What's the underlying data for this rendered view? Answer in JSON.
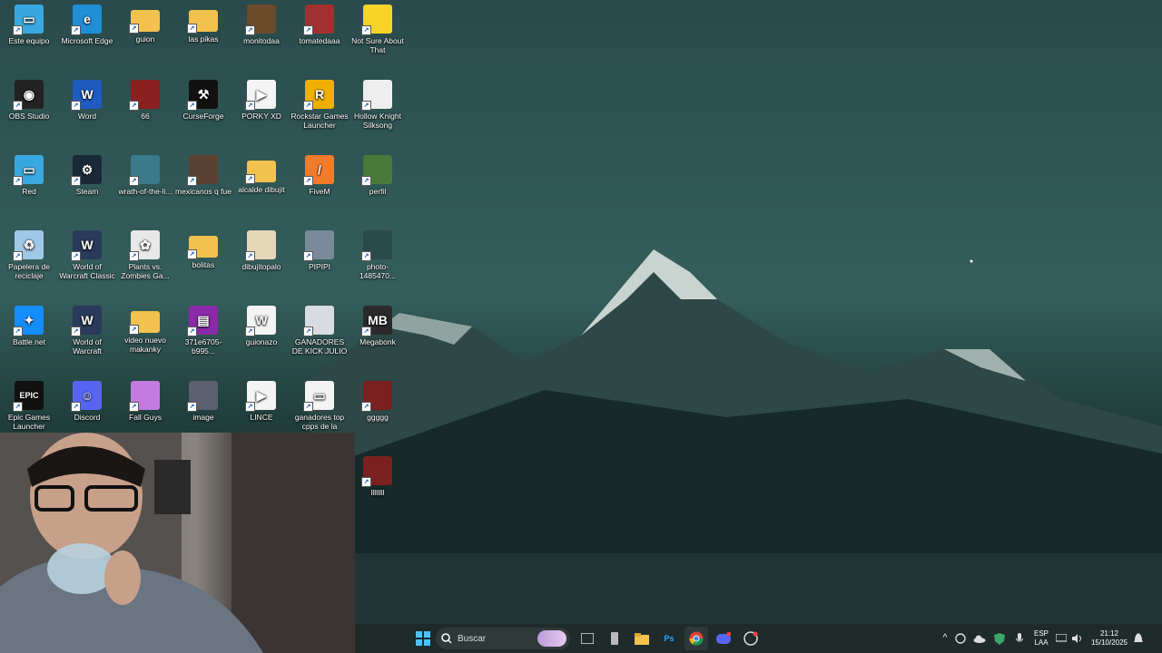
{
  "desktop": {
    "icons": [
      {
        "label": "Este equipo",
        "icon": "computer-icon",
        "color": "#3aa8e0",
        "glyph": "▭"
      },
      {
        "label": "Microsoft Edge",
        "icon": "edge-icon",
        "color": "#1f8fd6",
        "glyph": "e"
      },
      {
        "label": "guion",
        "icon": "folder-icon",
        "color": "#f2c14e",
        "glyph": ""
      },
      {
        "label": "las pikas",
        "icon": "folder-icon",
        "color": "#f2c14e",
        "glyph": ""
      },
      {
        "label": "monitodaa",
        "icon": "image-thumbnail-icon",
        "color": "#6b4a2a",
        "glyph": ""
      },
      {
        "label": "tomatedaaa",
        "icon": "image-thumbnail-icon",
        "color": "#a23030",
        "glyph": ""
      },
      {
        "label": "Not Sure About That",
        "icon": "duck-icon",
        "color": "#f5d327",
        "glyph": ""
      },
      {
        "label": "OBS Studio",
        "icon": "obs-icon",
        "color": "#222",
        "glyph": "◉"
      },
      {
        "label": "Word",
        "icon": "word-icon",
        "color": "#1d5bbf",
        "glyph": "W"
      },
      {
        "label": "66",
        "icon": "image-thumbnail-icon",
        "color": "#8a2020",
        "glyph": ""
      },
      {
        "label": "CurseForge",
        "icon": "curseforge-icon",
        "color": "#111",
        "glyph": "⚒"
      },
      {
        "label": "PORKY XD",
        "icon": "video-file-icon",
        "color": "#f4f4f4",
        "glyph": "▶"
      },
      {
        "label": "Rockstar Games Launcher",
        "icon": "rockstar-icon",
        "color": "#f0b000",
        "glyph": "R"
      },
      {
        "label": "Hollow Knight Silksong",
        "icon": "hollow-knight-icon",
        "color": "#eeeeee",
        "glyph": ""
      },
      {
        "label": "Red",
        "icon": "network-icon",
        "color": "#3aa8e0",
        "glyph": "▭"
      },
      {
        "label": "Steam",
        "icon": "steam-icon",
        "color": "#1b2838",
        "glyph": "⚙"
      },
      {
        "label": "wrath-of-the-li...",
        "icon": "image-thumbnail-icon",
        "color": "#3b7a8a",
        "glyph": ""
      },
      {
        "label": "mexicanos q fue",
        "icon": "image-thumbnail-icon",
        "color": "#5a4030",
        "glyph": ""
      },
      {
        "label": "alcalde dibujit",
        "icon": "folder-icon",
        "color": "#f2c14e",
        "glyph": ""
      },
      {
        "label": "FiveM",
        "icon": "fivem-icon",
        "color": "#f07b2a",
        "glyph": "/"
      },
      {
        "label": "perfil",
        "icon": "image-thumbnail-icon",
        "color": "#4a7a3a",
        "glyph": ""
      },
      {
        "label": "Papelera de reciclaje",
        "icon": "recycle-bin-icon",
        "color": "#9fc8e6",
        "glyph": "♻"
      },
      {
        "label": "World of Warcraft Classic",
        "icon": "wow-icon",
        "color": "#2a3a5a",
        "glyph": "W"
      },
      {
        "label": "Plants vs. Zombies Ga...",
        "icon": "pvz-icon",
        "color": "#e8e8e8",
        "glyph": "✿"
      },
      {
        "label": "bolitas",
        "icon": "folder-icon",
        "color": "#f2c14e",
        "glyph": ""
      },
      {
        "label": "dibujitopalo",
        "icon": "image-thumbnail-icon",
        "color": "#e6d6b8",
        "glyph": ""
      },
      {
        "label": "PIPIPI",
        "icon": "image-thumbnail-icon",
        "color": "#7a8a9a",
        "glyph": ""
      },
      {
        "label": "photo-1485470...",
        "icon": "image-thumbnail-icon",
        "color": "#2a4a4b",
        "glyph": ""
      },
      {
        "label": "Battle.net",
        "icon": "battlenet-icon",
        "color": "#148eff",
        "glyph": "✦"
      },
      {
        "label": "World of Warcraft",
        "icon": "wow-icon",
        "color": "#2a3a5a",
        "glyph": "W"
      },
      {
        "label": "video nuevo makanky",
        "icon": "folder-icon",
        "color": "#f2c14e",
        "glyph": ""
      },
      {
        "label": "371e6705-b995...",
        "icon": "archive-icon",
        "color": "#8a2aa8",
        "glyph": "▤"
      },
      {
        "label": "guionazo",
        "icon": "word-document-icon",
        "color": "#f4f4f4",
        "glyph": "W"
      },
      {
        "label": "GANADORES DE KICK JULIO",
        "icon": "image-thumbnail-icon",
        "color": "#d8dce2",
        "glyph": ""
      },
      {
        "label": "Megabonk",
        "icon": "megabonk-icon",
        "color": "#2a2a2a",
        "glyph": "MB"
      },
      {
        "label": "Epic Games Launcher",
        "icon": "epic-games-icon",
        "color": "#111",
        "glyph": "EPIC"
      },
      {
        "label": "Discord",
        "icon": "discord-icon",
        "color": "#5865f2",
        "glyph": "☺"
      },
      {
        "label": "Fall Guys",
        "icon": "fall-guys-icon",
        "color": "#c37be0",
        "glyph": ""
      },
      {
        "label": "image",
        "icon": "image-thumbnail-icon",
        "color": "#5a6070",
        "glyph": ""
      },
      {
        "label": "LINCE",
        "icon": "video-file-icon",
        "color": "#f4f4f4",
        "glyph": "▶"
      },
      {
        "label": "ganadores top cpps de la sem...",
        "icon": "image-thumbnail-icon",
        "color": "#f4f4f4",
        "glyph": "▭"
      },
      {
        "label": "ggggg",
        "icon": "image-thumbnail-icon",
        "color": "#7a2020",
        "glyph": ""
      },
      {
        "label": "llllllll",
        "icon": "image-thumbnail-icon",
        "color": "#7a2020",
        "glyph": ""
      }
    ]
  },
  "taskbar": {
    "search_placeholder": "Buscar",
    "language": "ESP",
    "language_sub": "LAA",
    "time": "21:12",
    "date": "15/10/2025"
  }
}
